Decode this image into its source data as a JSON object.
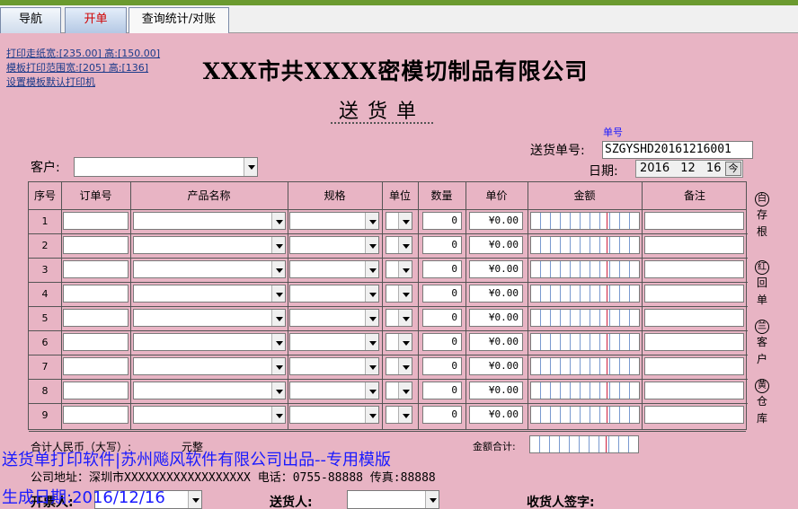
{
  "tabs": [
    {
      "label": "导航"
    },
    {
      "label": "开单"
    },
    {
      "label": "查询统计/对账"
    }
  ],
  "print_links": [
    {
      "label": "打印走纸宽:[235.00] 高:[150.00]"
    },
    {
      "label": "模板打印范围宽:[205] 高:[136]"
    },
    {
      "label": "设置模板默认打印机"
    }
  ],
  "company_name": "XXX市共XXXX密模切制品有限公司",
  "doc_title": "送货单",
  "order_no": {
    "caption": "单号",
    "label": "送货单号:",
    "value": "SZGYSHD20161216001"
  },
  "date": {
    "label": "日期:",
    "year": "2016",
    "month": "12",
    "day": "16",
    "button": "今"
  },
  "customer_label": "客户:",
  "columns": [
    "序号",
    "订单号",
    "产品名称",
    "规格",
    "单位",
    "数量",
    "单价",
    "金额",
    "备注"
  ],
  "rows": [
    {
      "no": "1",
      "qty": "0",
      "price": "¥0.00"
    },
    {
      "no": "2",
      "qty": "0",
      "price": "¥0.00"
    },
    {
      "no": "3",
      "qty": "0",
      "price": "¥0.00"
    },
    {
      "no": "4",
      "qty": "0",
      "price": "¥0.00"
    },
    {
      "no": "5",
      "qty": "0",
      "price": "¥0.00"
    },
    {
      "no": "6",
      "qty": "0",
      "price": "¥0.00"
    },
    {
      "no": "7",
      "qty": "0",
      "price": "¥0.00"
    },
    {
      "no": "8",
      "qty": "0",
      "price": "¥0.00"
    },
    {
      "no": "9",
      "qty": "0",
      "price": "¥0.00"
    }
  ],
  "side_labels": [
    {
      "circle": "白",
      "lines": [
        "存",
        "根"
      ]
    },
    {
      "circle": "红",
      "lines": [
        "回",
        "单"
      ]
    },
    {
      "circle": "兰",
      "lines": [
        "客",
        "户"
      ]
    },
    {
      "circle": "黄",
      "lines": [
        "仓",
        "库"
      ]
    }
  ],
  "total": {
    "label": "合计人民币（大写）:",
    "value": "元整",
    "amount_label": "金额合计:"
  },
  "overlay": {
    "line1": "送货单打印软件|苏州飚风软件有限公司出品--专用模版",
    "line2": "生成日期:2016/12/16"
  },
  "footer": {
    "address": "公司地址：深圳市XXXXXXXXXXXXXXXXXX  电话：0755-88888 传真:88888",
    "issuer": "开票人:",
    "deliverer": "送货人:",
    "receiver": "收货人签字:"
  }
}
